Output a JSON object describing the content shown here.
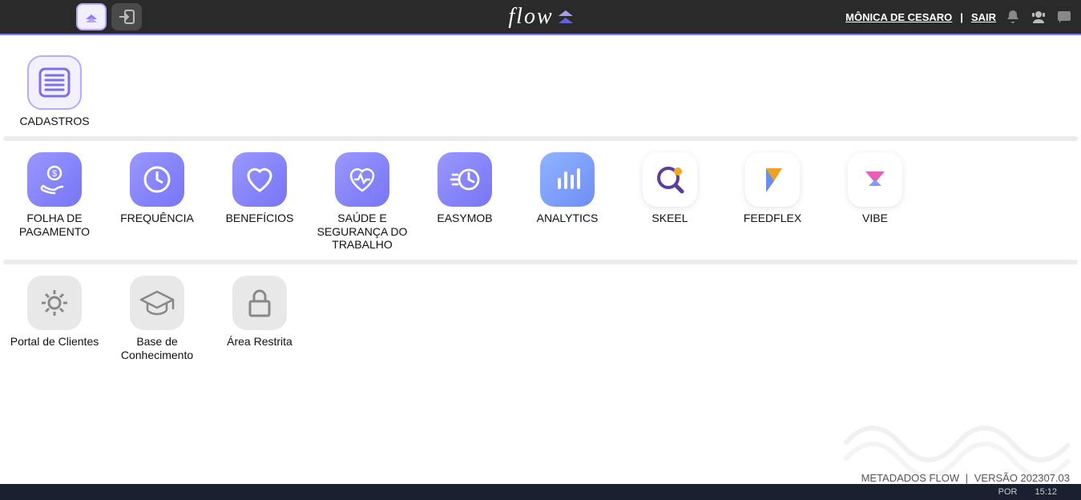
{
  "header": {
    "brand": "flow",
    "user": "MÔNICA DE CESARO",
    "logout": "SAIR"
  },
  "section1": {
    "items": [
      {
        "label": "CADASTROS",
        "icon": "lines"
      }
    ]
  },
  "section2": {
    "items": [
      {
        "label": "FOLHA DE PAGAMENTO",
        "icon": "pay"
      },
      {
        "label": "FREQUÊNCIA",
        "icon": "clock"
      },
      {
        "label": "BENEFÍCIOS",
        "icon": "heart"
      },
      {
        "label": "SAÚDE E SEGURANÇA DO TRABALHO",
        "icon": "heartbeat"
      },
      {
        "label": "EASYMOB",
        "icon": "speed"
      },
      {
        "label": "ANALYTICS",
        "icon": "bars"
      },
      {
        "label": "SKEEL",
        "icon": "magnify"
      },
      {
        "label": "FEEDFLEX",
        "icon": "fold"
      },
      {
        "label": "VIBE",
        "icon": "vibe"
      }
    ]
  },
  "section3": {
    "items": [
      {
        "label": "Portal de Clientes",
        "icon": "gear"
      },
      {
        "label": "Base de Conhecimento",
        "icon": "grad"
      },
      {
        "label": "Área Restrita",
        "icon": "lock"
      }
    ]
  },
  "footer": {
    "brand": "METADADOS FLOW",
    "version_label": "VERSÃO 202307.03"
  },
  "taskbar": {
    "lang": "POR",
    "time": "15:12"
  }
}
